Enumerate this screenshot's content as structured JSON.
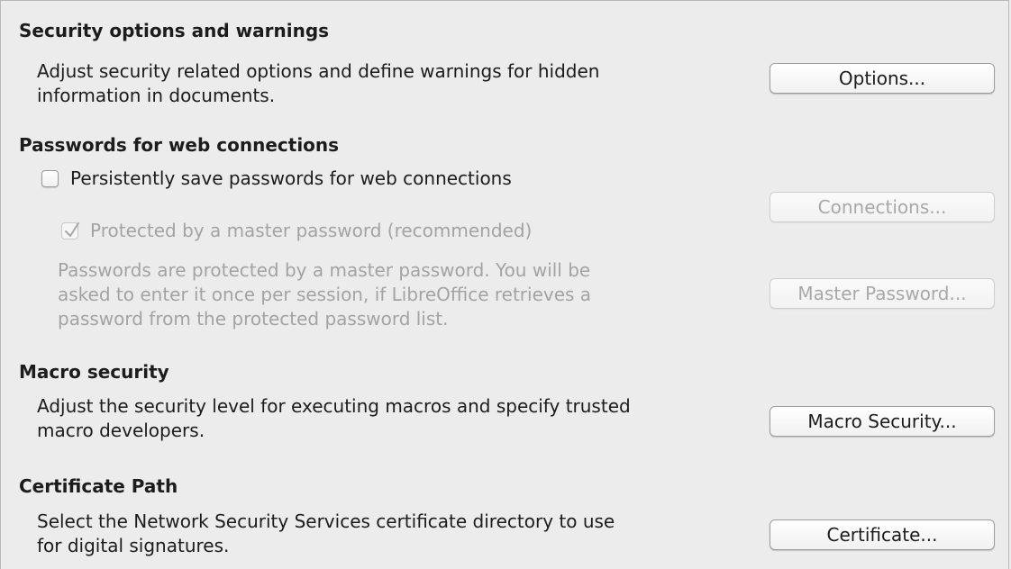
{
  "security_options": {
    "heading": "Security options and warnings",
    "desc_line1": "Adjust security related options and define warnings for hidden",
    "desc_line2": "information in documents.",
    "button": "Options..."
  },
  "passwords": {
    "heading": "Passwords for web connections",
    "persist_label": "Persistently save passwords for web connections",
    "persist_checked": false,
    "master_label": "Protected by a master password (recommended)",
    "master_checked": true,
    "connections_button": "Connections...",
    "note_line1": "Passwords are protected by a master password. You will be",
    "note_line2": "asked to enter it once per session, if LibreOffice retrieves a",
    "note_line3": "password from the protected password list.",
    "master_password_button": "Master Password..."
  },
  "macro": {
    "heading": "Macro security",
    "desc_line1": "Adjust the security level for executing macros and specify trusted",
    "desc_line2": "macro developers.",
    "button": "Macro Security..."
  },
  "certificate": {
    "heading": "Certificate Path",
    "desc_line1": "Select the Network Security Services certificate directory to use",
    "desc_line2": "for digital signatures.",
    "button": "Certificate..."
  }
}
